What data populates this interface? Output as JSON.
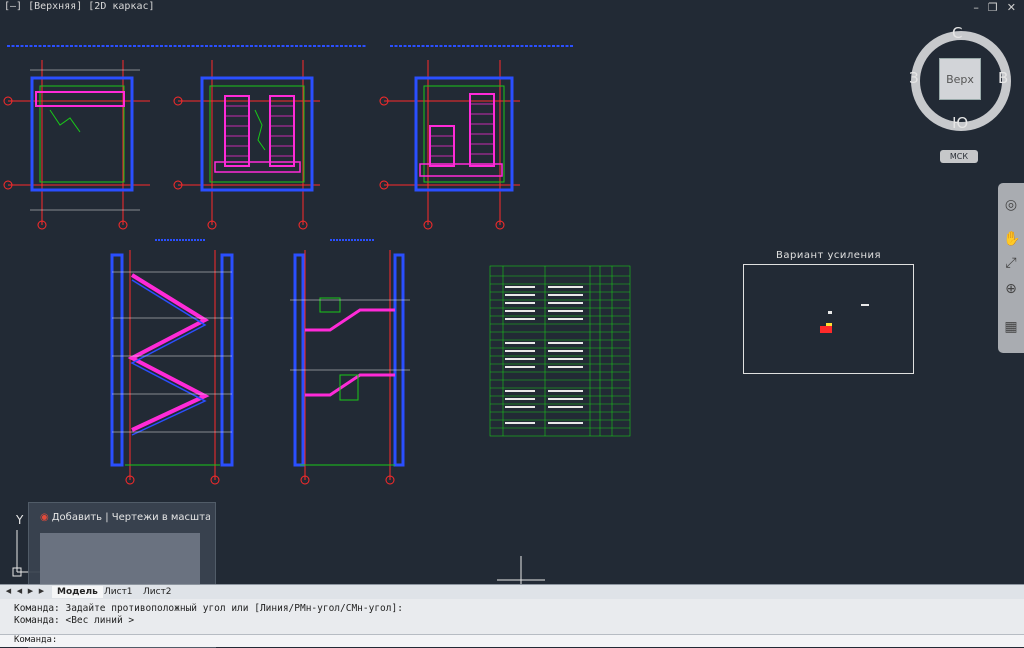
{
  "viewport": {
    "label": "[–] [Верхняя] [2D каркас]"
  },
  "window_controls": {
    "restore_icon": "restore-icon",
    "maximize_icon": "maximize-icon",
    "close_label": "✕"
  },
  "viewcube": {
    "north": "С",
    "south": "Ю",
    "east": "В",
    "west": "З",
    "face": "Верх",
    "wcs": "МСК"
  },
  "drawing": {
    "variant_title": "Вариант  усиления"
  },
  "taskbar_preview": {
    "title": "Добавить | Чертежи в масшта..."
  },
  "tabs": [
    {
      "label": "Модель",
      "active": true
    },
    {
      "label": "Лист1",
      "active": false
    },
    {
      "label": "Лист2",
      "active": false
    }
  ],
  "command": {
    "line1": "Команда: Задайте противоположный угол или [Линия/РМн-угол/СМн-угол]:",
    "line2": "Команда:  <Вес линий >",
    "input": "Команда:"
  },
  "colors": {
    "background": "#222a35",
    "red": "#ff2a2a",
    "green": "#19c819",
    "magenta": "#ff2ad8",
    "blue": "#2a4fff",
    "white": "#e8e8e8"
  }
}
